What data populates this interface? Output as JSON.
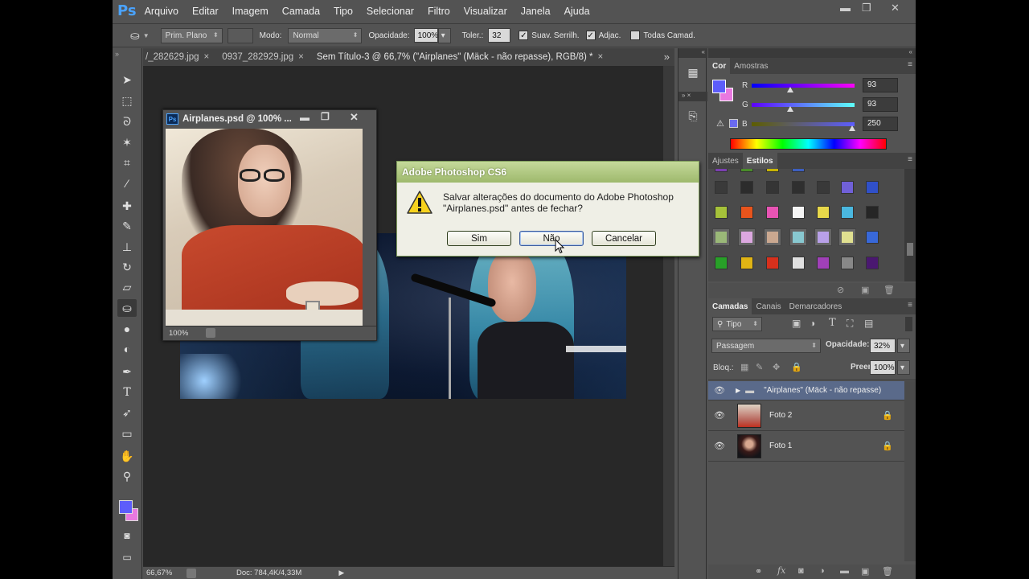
{
  "app": {
    "logo": "Ps",
    "menu": [
      "Arquivo",
      "Editar",
      "Imagem",
      "Camada",
      "Tipo",
      "Selecionar",
      "Filtro",
      "Visualizar",
      "Janela",
      "Ajuda"
    ]
  },
  "options": {
    "preset": "Prim. Plano",
    "mode_label": "Modo:",
    "mode_value": "Normal",
    "opacity_label": "Opacidade:",
    "opacity_value": "100%",
    "tolerance_label": "Toler.:",
    "tolerance_value": "32",
    "antialias_label": "Suav. Serrilh.",
    "contiguous_label": "Adjac.",
    "all_layers_label": "Todas Camad."
  },
  "tabs": [
    {
      "label": "/_282629.jpg"
    },
    {
      "label": "0937_282929.jpg"
    },
    {
      "label": "Sem Título-3 @ 66,7% (\"Airplanes\" (Mäck - não repasse), RGB/8) *"
    }
  ],
  "tabs_more": "»",
  "status": {
    "zoom": "66,67%",
    "doc": "Doc: 784,4K/4,33M"
  },
  "doc_window": {
    "title": "Airplanes.psd @ 100% ...",
    "zoom": "100%"
  },
  "dialog": {
    "title": "Adobe Photoshop CS6",
    "message_line1": "Salvar alterações do documento do Adobe Photoshop",
    "message_line2": "\"Airplanes.psd\" antes de fechar?",
    "btn_yes": "Sim",
    "btn_no": "Não",
    "btn_cancel": "Cancelar"
  },
  "color_panel": {
    "tabs": [
      "Cor",
      "Amostras"
    ],
    "r_label": "R",
    "r": "93",
    "g_label": "G",
    "g": "93",
    "b_label": "B",
    "b": "250",
    "fg_color": "#5d5dfa",
    "bg_color": "#e878e0"
  },
  "styles_panel": {
    "tabs": [
      "Ajustes",
      "Estilos"
    ]
  },
  "layers_panel": {
    "tabs": [
      "Camadas",
      "Canais",
      "Demarcadores"
    ],
    "filter": "Tipo",
    "blend": "Passagem",
    "opacity_label": "Opacidade:",
    "opacity": "32%",
    "lock_label": "Bloq.:",
    "fill_label": "Preen.:",
    "fill": "100%",
    "layers": [
      {
        "name": "\"Airplanes\" (Mäck - não repasse)"
      },
      {
        "name": "Foto 2"
      },
      {
        "name": "Foto 1"
      }
    ]
  }
}
